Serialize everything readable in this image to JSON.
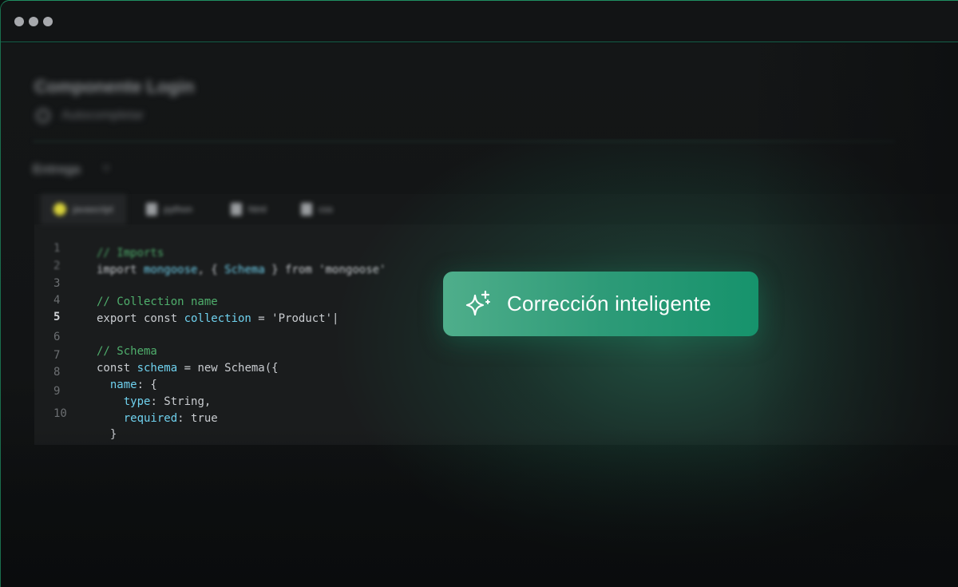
{
  "window": {
    "dots": [
      "dot",
      "dot",
      "dot"
    ]
  },
  "header": {
    "title": "Componente Login",
    "subtitle": "Autocompletar"
  },
  "section": {
    "label": "Entrega",
    "chevron": "˅"
  },
  "tabs": [
    {
      "label": "javascript",
      "active": true
    },
    {
      "label": "python",
      "active": false
    },
    {
      "label": "html",
      "active": false
    },
    {
      "label": "css",
      "active": false
    }
  ],
  "code": {
    "line_numbers": [
      "1",
      "2",
      "3",
      "4",
      "5",
      "6",
      "7",
      "8",
      "9",
      "10"
    ],
    "lines": [
      {
        "comment": "// Imports"
      },
      {
        "kw1": "import ",
        "var1": "mongoose",
        "p1": ", { ",
        "var2": "Schema",
        "p2": " } from ",
        "str": "'mongoose'"
      },
      {
        "comment": "// Collection name"
      },
      {
        "kw1": "export const ",
        "var1": "collection",
        "p1": " = ",
        "str": "'Product'|"
      },
      {
        "comment": "// Schema"
      },
      {
        "kw1": "const ",
        "var1": "schema",
        "p1": " = new Schema({"
      },
      {
        "var1": "  name",
        "p1": ": {"
      },
      {
        "var1": "    type",
        "p1": ": String,"
      },
      {
        "var1": "    required",
        "p1": ": true"
      },
      {
        "p1": "  }"
      }
    ]
  },
  "cta": {
    "label": "Corrección inteligente",
    "icon": "sparkles-icon"
  },
  "colors": {
    "accent": "#16936c",
    "accent_light": "#4fae8b",
    "comment": "#4fae6c",
    "identifier": "#6fd1ee"
  }
}
